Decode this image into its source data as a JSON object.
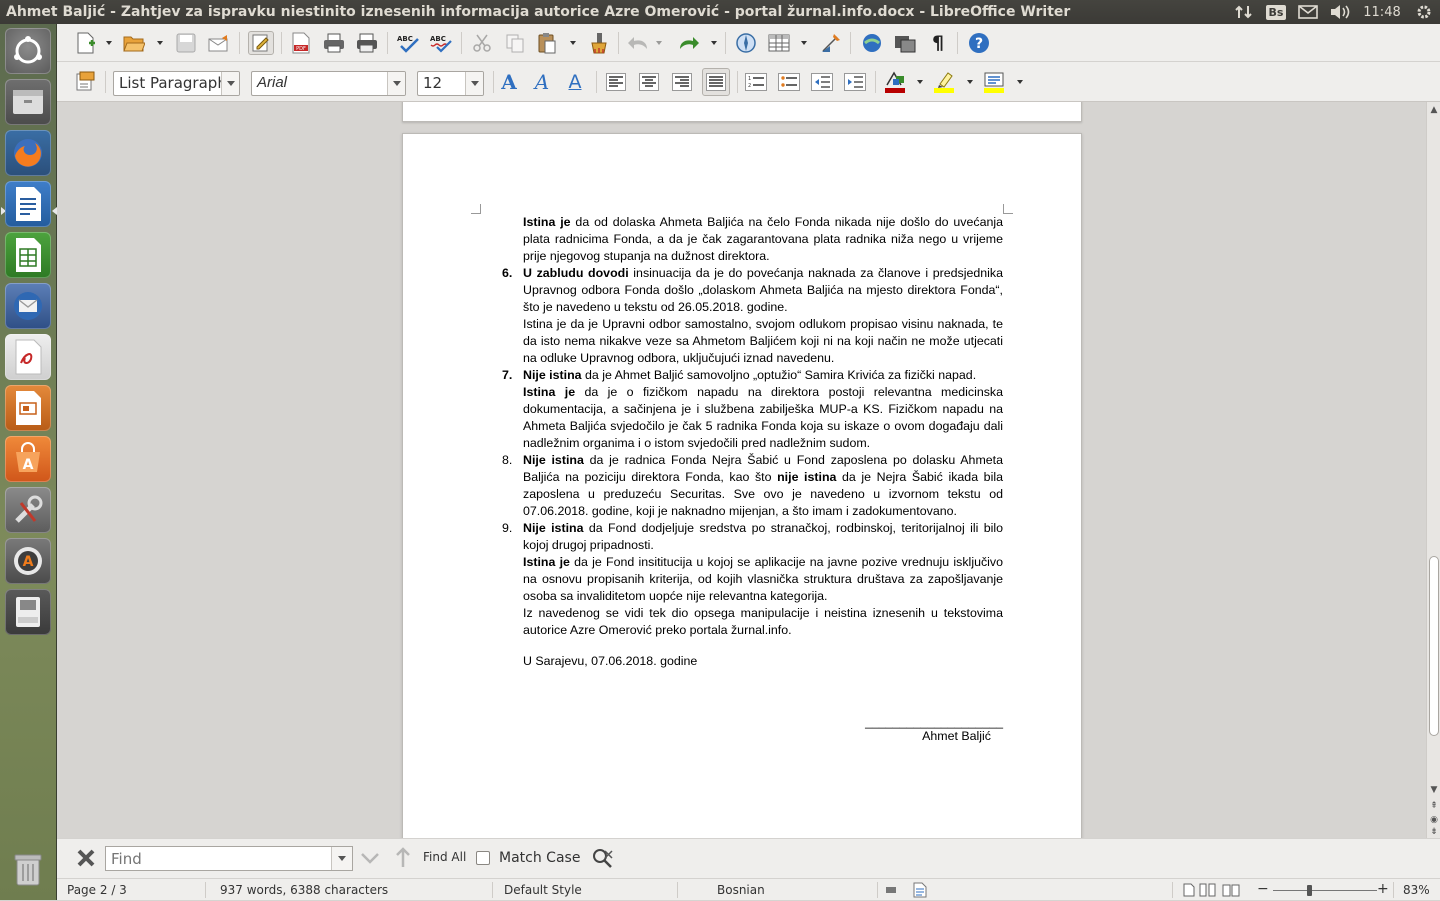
{
  "window": {
    "title": "Ahmet Baljić -  Zahtjev za ispravku niestinito iznesenih informacija autorice Azre Omerović - portal žurnal.info.docx - LibreOffice Writer"
  },
  "tray": {
    "keyboard_layout": "Bs",
    "clock": "11:48"
  },
  "formatting": {
    "paragraph_style": "List Paragraph",
    "font_name": "Arial",
    "font_size": "12"
  },
  "document": {
    "p1_bold": "Istina je",
    "p1_rest": " da od dolaska Ahmeta Baljića na čelo Fonda nikada nije došlo do uvećanja plata radnicima Fonda, a da je čak zagarantovana plata radnika niža nego u vrijeme prije njegovog stupanja na dužnost direktora.",
    "item6_num": "6.",
    "item6_bold": "U zabludu dovodi",
    "item6_rest": " insinuacija da je do povećanja naknada za članove i predsjednika Upravnog odbora Fonda došlo „dolaskom Ahmeta Baljića na mjesto direktora Fonda“, što je navedeno u tekstu od 26.05.2018. godine.",
    "item6_p2": "Istina je da je Upravni odbor samostalno, svojom odlukom propisao visinu naknada, te da isto nema nikakve veze sa Ahmetom Baljićem koji ni na koji način ne može utjecati na odluke Upravnog odbora, uključujući iznad navedenu.",
    "item7_num": "7.",
    "item7_bold": "Nije istina",
    "item7_rest": " da je Ahmet Baljić samovoljno „optužio“ Samira Krivića za fizički napad.",
    "item7_p2_bold": "Istina je",
    "item7_p2_rest": " da je o fizičkom napadu na direktora postoji relevantna medicinska dokumentacija, a sačinjena je i službena zabilješka MUP-a KS. Fizičkom napadu na Ahmeta Baljića svjedočilo je čak 5 radnika Fonda koja su iskaze o ovom događaju dali nadležnim organima i o istom svjedočili pred nadležnim sudom.",
    "item8_num": "8.",
    "item8_bold": "Nije istina",
    "item8_rest1": " da je radnica Fonda Nejra Šabić u Fond zaposlena po dolasku Ahmeta Baljića na poziciju direktora Fonda, kao što ",
    "item8_bold2": "nije istina",
    "item8_rest2": " da je Nejra Šabić ikada bila zaposlena u preduzeću Securitas. Sve ovo je navedeno u izvornom tekstu od 07.06.2018. godine, koji je naknadno mijenjan, a što imam i zadokumentovano.",
    "item9_num": "9.",
    "item9_bold": "Nije istina",
    "item9_rest": " da Fond dodjeljuje sredstva po stranačkoj, rodbinskoj, teritorijalnoj ili bilo kojoj drugoj pripadnosti.",
    "item9_p2_bold": "Istina je",
    "item9_p2_rest": " da je Fond insititucija u kojoj se aplikacije na javne pozive vrednuju isključivo na osnovu propisanih kriterija, od kojih vlasnička struktura društava za zapošljavanje osoba sa invaliditetom uopće nije relevantna kategorija.",
    "item9_p3": "Iz navedenog se vidi tek dio opsega manipulacije i neistina iznesenih u tekstovima autorice Azre Omerović preko portala žurnal.info.",
    "place_date": "U Sarajevu, 07.06.2018. godine",
    "signature_line": "____________________",
    "signature_name": "Ahmet Baljić"
  },
  "findbar": {
    "placeholder": "Find",
    "find_all": "Find All",
    "match_case": "Match Case"
  },
  "status": {
    "page": "Page 2 / 3",
    "words": "937 words, 6388 characters",
    "style": "Default Style",
    "language": "Bosnian",
    "zoom": "83%"
  },
  "colors": {
    "font_color": "#b80000",
    "highlight": "#ffff00",
    "background_fill": "#ffff00"
  }
}
